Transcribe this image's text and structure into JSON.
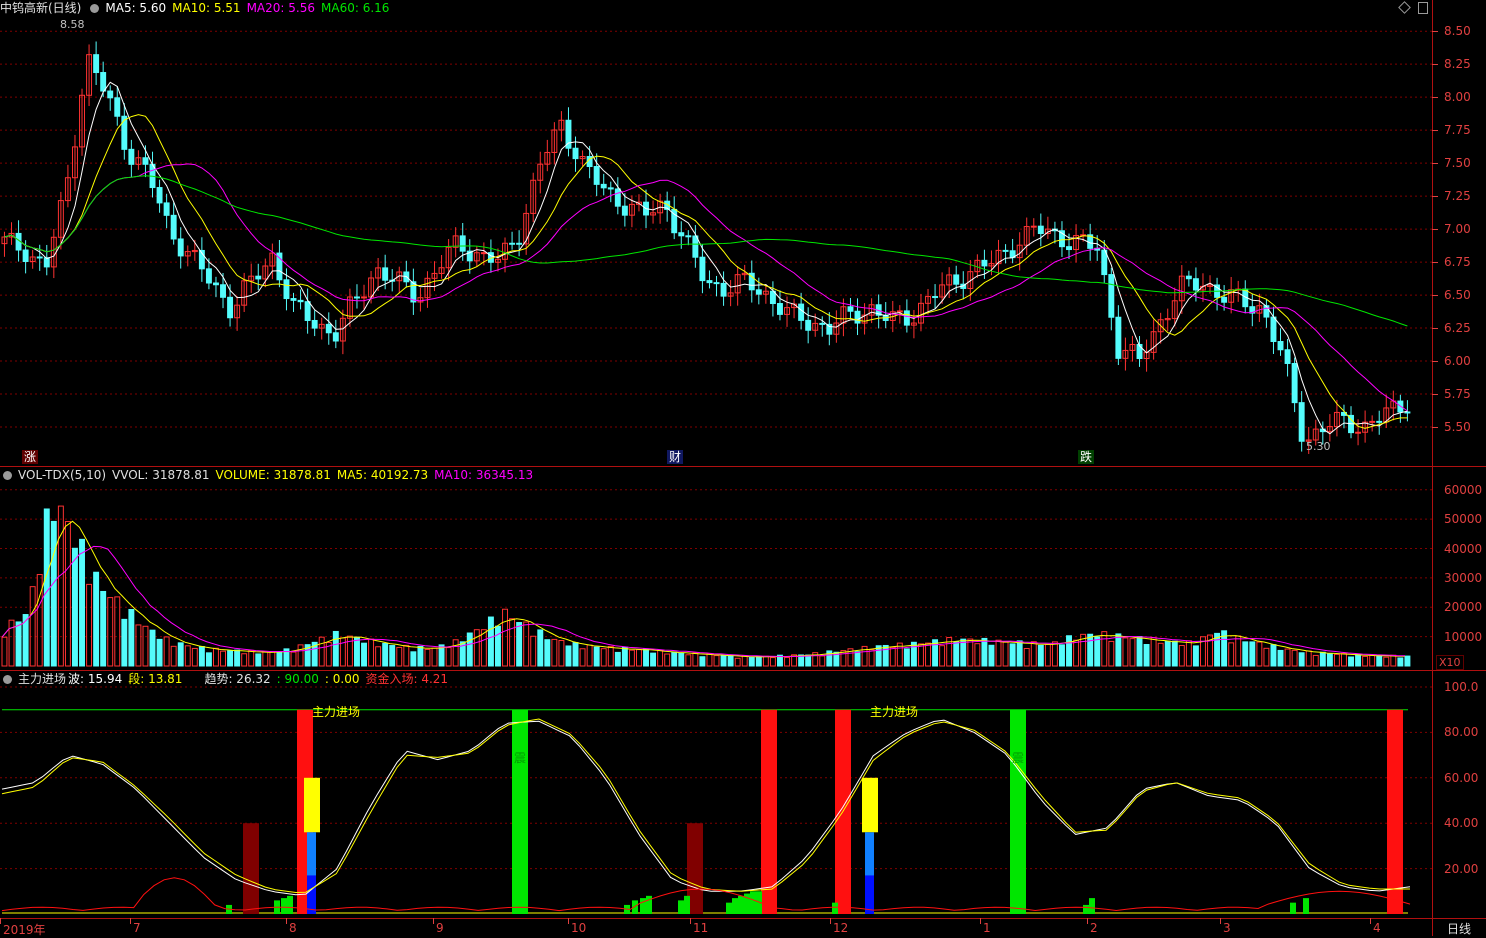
{
  "window": {
    "icons": [
      "diamond-icon",
      "restore-icon"
    ]
  },
  "price_panel": {
    "title": "中钨高新(日线)",
    "ma5": "MA5: 5.60",
    "ma10": "MA10: 5.51",
    "ma20": "MA20: 5.56",
    "ma60": "MA60: 6.16",
    "high_label": "8.58",
    "low_label": "5.30",
    "markers": {
      "zhang": "涨",
      "cai": "财",
      "die": "跌"
    }
  },
  "volume_panel": {
    "label": "VOL-TDX(5,10)",
    "vvol": "VVOL: 31878.81",
    "volume": "VOLUME: 31878.81",
    "ma5": "MA5: 40192.73",
    "ma10": "MA10: 36345.13",
    "unit": "X10"
  },
  "indicator_panel": {
    "name": "主力进场",
    "bo": "波: 15.94",
    "duan": "段: 13.81",
    "qushi": "趋势: 26.32",
    "v1": ": 90.00",
    "v2": ": 0.00",
    "inflow": "资金入场: 4.21",
    "annotation": "主力进场",
    "bar_text": "震"
  },
  "price_axis": [
    "8.50",
    "8.25",
    "8.00",
    "7.75",
    "7.50",
    "7.25",
    "7.00",
    "6.75",
    "6.50",
    "6.25",
    "6.00",
    "5.75",
    "5.50"
  ],
  "volume_axis": [
    "60000",
    "50000",
    "40000",
    "30000",
    "20000",
    "10000"
  ],
  "indicator_axis": [
    "100.0",
    "80.00",
    "60.00",
    "40.00",
    "20.00"
  ],
  "dates": [
    "2019年",
    "7",
    "8",
    "9",
    "10",
    "11",
    "12",
    "1",
    "2",
    "3",
    "4"
  ],
  "period_tab": "日线",
  "colors": {
    "up": "#ff3232",
    "down": "#54fcfc",
    "ma5": "#ffffff",
    "ma10": "#ffff00",
    "ma20": "#ff00ff",
    "ma60": "#00e600",
    "grid": "#800000",
    "axis_text": "#e04040"
  },
  "chart_data": [
    {
      "type": "candlestick",
      "x_axis": [
        "2019年",
        "7",
        "8",
        "9",
        "10",
        "11",
        "12",
        "1",
        "2",
        "3",
        "4"
      ],
      "ylim": [
        5.25,
        8.6
      ],
      "closes": [
        6.9,
        6.85,
        6.7,
        7.3,
        8.3,
        8.0,
        7.6,
        7.4,
        7.0,
        6.8,
        6.6,
        6.4,
        6.6,
        6.8,
        6.4,
        6.3,
        6.2,
        6.45,
        6.7,
        6.6,
        6.5,
        6.7,
        6.9,
        6.8,
        6.75,
        7.0,
        7.5,
        7.8,
        7.5,
        7.3,
        7.2,
        7.1,
        7.2,
        6.9,
        6.6,
        6.55,
        6.6,
        6.5,
        6.35,
        6.3,
        6.25,
        6.35,
        6.4,
        6.3,
        6.35,
        6.5,
        6.6,
        6.7,
        6.75,
        6.9,
        7.0,
        6.95,
        6.9,
        6.85,
        6.1,
        6.0,
        6.3,
        6.55,
        6.6,
        6.5,
        6.45,
        6.4,
        6.0,
        5.4,
        5.5,
        5.55,
        5.5,
        5.6,
        5.7
      ],
      "ma_values": {
        "MA5": 5.6,
        "MA10": 5.51,
        "MA20": 5.56,
        "MA60": 6.16
      },
      "high": 8.58,
      "low": 5.3
    },
    {
      "type": "bar",
      "ylim": [
        0,
        63000
      ],
      "values": [
        14000,
        20000,
        63000,
        48000,
        30000,
        22000,
        14000,
        9000,
        7000,
        6000,
        5500,
        5000,
        6000,
        9000,
        12000,
        10000,
        8000,
        7000,
        6500,
        9000,
        14000,
        20000,
        15000,
        10000,
        8000,
        7000,
        6500,
        6000,
        5000,
        4500,
        4000,
        3500,
        3500,
        3800,
        4500,
        5500,
        6500,
        7500,
        8000,
        9000,
        10000,
        9500,
        9000,
        8500,
        8000,
        11000,
        12000,
        11000,
        10000,
        9000,
        8500,
        13000,
        10000,
        8000,
        6000,
        5000,
        4500,
        4000,
        3800,
        3500
      ],
      "ma5": 40192.73,
      "ma10": 36345.13
    },
    {
      "type": "line",
      "ylim": [
        0,
        100
      ],
      "series": [
        {
          "name": "波",
          "values": [
            55,
            58,
            70,
            66,
            55,
            40,
            25,
            15,
            10,
            8,
            20,
            48,
            72,
            68,
            72,
            84,
            85,
            78,
            60,
            35,
            15,
            10,
            10,
            12,
            25,
            45,
            70,
            80,
            86,
            80,
            70,
            50,
            35,
            38,
            55,
            58,
            52,
            50,
            40,
            20,
            12,
            10,
            12
          ]
        },
        {
          "name": "段",
          "values": [
            53,
            56,
            69,
            67,
            56,
            42,
            27,
            17,
            11,
            9,
            18,
            45,
            70,
            69,
            71,
            83,
            86,
            79,
            62,
            37,
            17,
            11,
            10,
            11,
            23,
            43,
            68,
            79,
            85,
            81,
            71,
            52,
            36,
            37,
            54,
            58,
            53,
            51,
            41,
            22,
            13,
            11,
            11
          ]
        }
      ],
      "values_shown": {
        "波": 15.94,
        "段": 13.81,
        "趋势": 26.32,
        "资金入场": 4.21
      }
    }
  ]
}
